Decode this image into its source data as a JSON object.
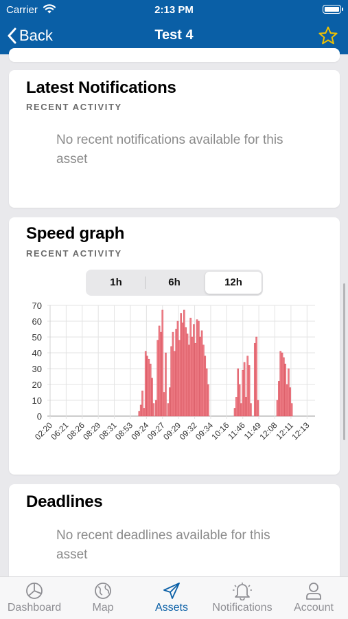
{
  "status_bar": {
    "carrier": "Carrier",
    "time": "2:13 PM"
  },
  "nav": {
    "back_label": "Back",
    "title": "Test 4",
    "favorite_icon": "star-outline-icon"
  },
  "notifications_card": {
    "title": "Latest Notifications",
    "subtitle": "RECENT ACTIVITY",
    "empty_message": "No recent notifications available for this asset"
  },
  "speed_card": {
    "title": "Speed graph",
    "subtitle": "RECENT ACTIVITY",
    "ranges": [
      "1h",
      "6h",
      "12h"
    ],
    "selected_range": "12h"
  },
  "deadlines_card": {
    "title": "Deadlines",
    "empty_message": "No recent deadlines available for this asset"
  },
  "tabs": [
    {
      "label": "Dashboard",
      "icon": "dashboard-icon",
      "active": false
    },
    {
      "label": "Map",
      "icon": "globe-icon",
      "active": false
    },
    {
      "label": "Assets",
      "icon": "paper-plane-icon",
      "active": true
    },
    {
      "label": "Notifications",
      "icon": "bell-icon",
      "active": false
    },
    {
      "label": "Account",
      "icon": "person-icon",
      "active": false
    }
  ],
  "colors": {
    "brand": "#0a5fa6",
    "favorite_star": "#f2c200",
    "bar_fill": "#ee7c85",
    "bar_stroke": "#d85560"
  },
  "chart_data": {
    "type": "bar",
    "title": "",
    "xlabel": "",
    "ylabel": "",
    "ylim": [
      0,
      70
    ],
    "yticks": [
      0,
      10,
      20,
      30,
      40,
      50,
      60,
      70
    ],
    "grid": true,
    "legend": "none",
    "tick_labels": [
      "02:20",
      "06:21",
      "08:26",
      "08:29",
      "08:31",
      "08:53",
      "09:24",
      "09:27",
      "09:29",
      "09:32",
      "09:34",
      "10:16",
      "11:46",
      "11:49",
      "12:08",
      "12:11",
      "12:13"
    ],
    "x_range": [
      0,
      16.5
    ],
    "bars": [
      [
        5.55,
        3
      ],
      [
        5.65,
        7
      ],
      [
        5.75,
        16
      ],
      [
        5.85,
        5
      ],
      [
        5.95,
        41
      ],
      [
        6.05,
        38
      ],
      [
        6.15,
        36
      ],
      [
        6.25,
        33
      ],
      [
        6.35,
        24
      ],
      [
        6.45,
        8
      ],
      [
        6.6,
        10
      ],
      [
        6.7,
        48
      ],
      [
        6.8,
        57
      ],
      [
        6.9,
        53
      ],
      [
        7.0,
        67
      ],
      [
        7.1,
        15
      ],
      [
        7.2,
        40
      ],
      [
        7.35,
        8
      ],
      [
        7.45,
        18
      ],
      [
        7.55,
        44
      ],
      [
        7.65,
        53
      ],
      [
        7.75,
        41
      ],
      [
        7.85,
        55
      ],
      [
        7.95,
        60
      ],
      [
        8.05,
        48
      ],
      [
        8.15,
        65
      ],
      [
        8.25,
        59
      ],
      [
        8.35,
        67
      ],
      [
        8.45,
        56
      ],
      [
        8.55,
        52
      ],
      [
        8.65,
        45
      ],
      [
        8.75,
        62
      ],
      [
        8.85,
        50
      ],
      [
        8.95,
        58
      ],
      [
        9.05,
        46
      ],
      [
        9.15,
        61
      ],
      [
        9.25,
        60
      ],
      [
        9.35,
        50
      ],
      [
        9.45,
        54
      ],
      [
        9.55,
        45
      ],
      [
        9.65,
        38
      ],
      [
        9.75,
        30
      ],
      [
        9.85,
        20
      ],
      [
        11.5,
        5
      ],
      [
        11.6,
        12
      ],
      [
        11.7,
        30
      ],
      [
        11.8,
        20
      ],
      [
        11.9,
        8
      ],
      [
        12.0,
        29
      ],
      [
        12.1,
        34
      ],
      [
        12.2,
        12
      ],
      [
        12.3,
        38
      ],
      [
        12.4,
        32
      ],
      [
        12.5,
        8
      ],
      [
        12.75,
        46
      ],
      [
        12.85,
        50
      ],
      [
        12.95,
        10
      ],
      [
        14.15,
        10
      ],
      [
        14.25,
        22
      ],
      [
        14.35,
        41
      ],
      [
        14.45,
        40
      ],
      [
        14.55,
        37
      ],
      [
        14.65,
        33
      ],
      [
        14.75,
        20
      ],
      [
        14.85,
        30
      ],
      [
        14.95,
        18
      ],
      [
        15.05,
        8
      ]
    ]
  }
}
